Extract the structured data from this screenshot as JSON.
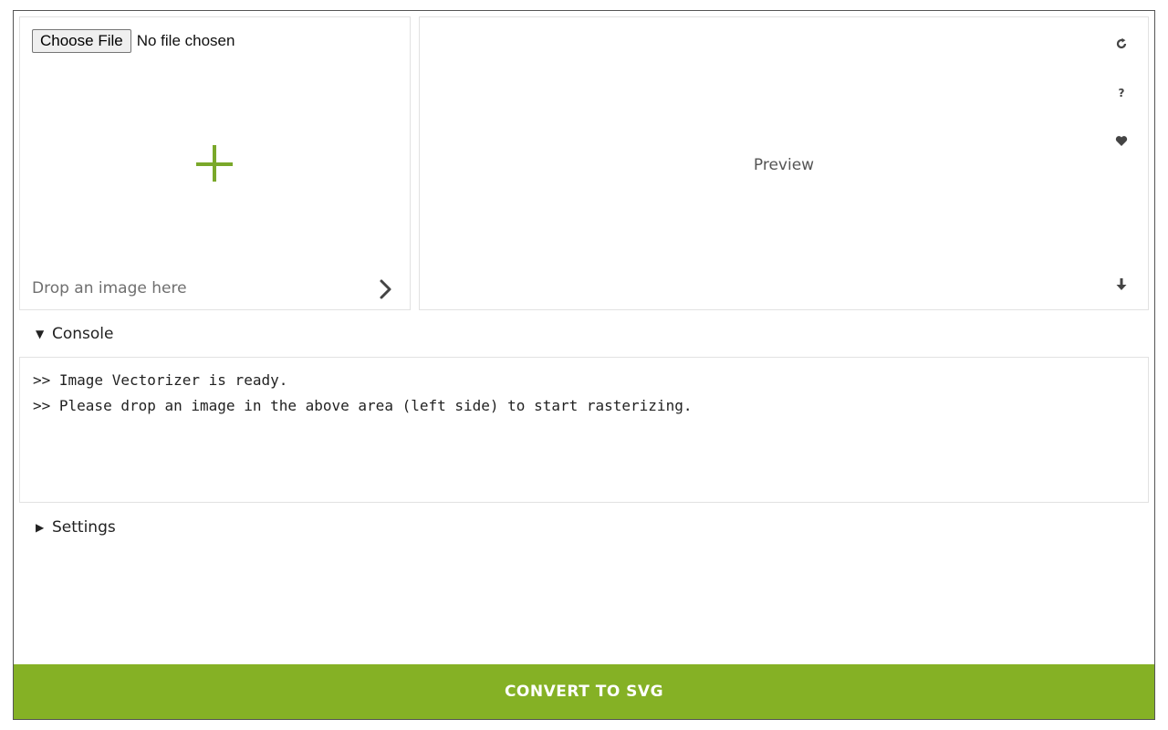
{
  "input": {
    "file_button_label": "Choose File",
    "file_status": "No file chosen",
    "drop_label": "Drop an image here"
  },
  "preview": {
    "label": "Preview",
    "tools": {
      "refresh": "refresh-icon",
      "help": "?",
      "favorite": "heart-icon",
      "download": "download-icon"
    }
  },
  "console": {
    "title": "Console",
    "expanded": true,
    "lines": [
      ">> Image Vectorizer is ready.",
      ">> Please drop an image in the above area (left side) to start rasterizing."
    ]
  },
  "settings": {
    "title": "Settings",
    "expanded": false
  },
  "actions": {
    "convert_label": "CONVERT TO SVG"
  },
  "colors": {
    "accent": "#85b125",
    "plus": "#7aa82a"
  }
}
